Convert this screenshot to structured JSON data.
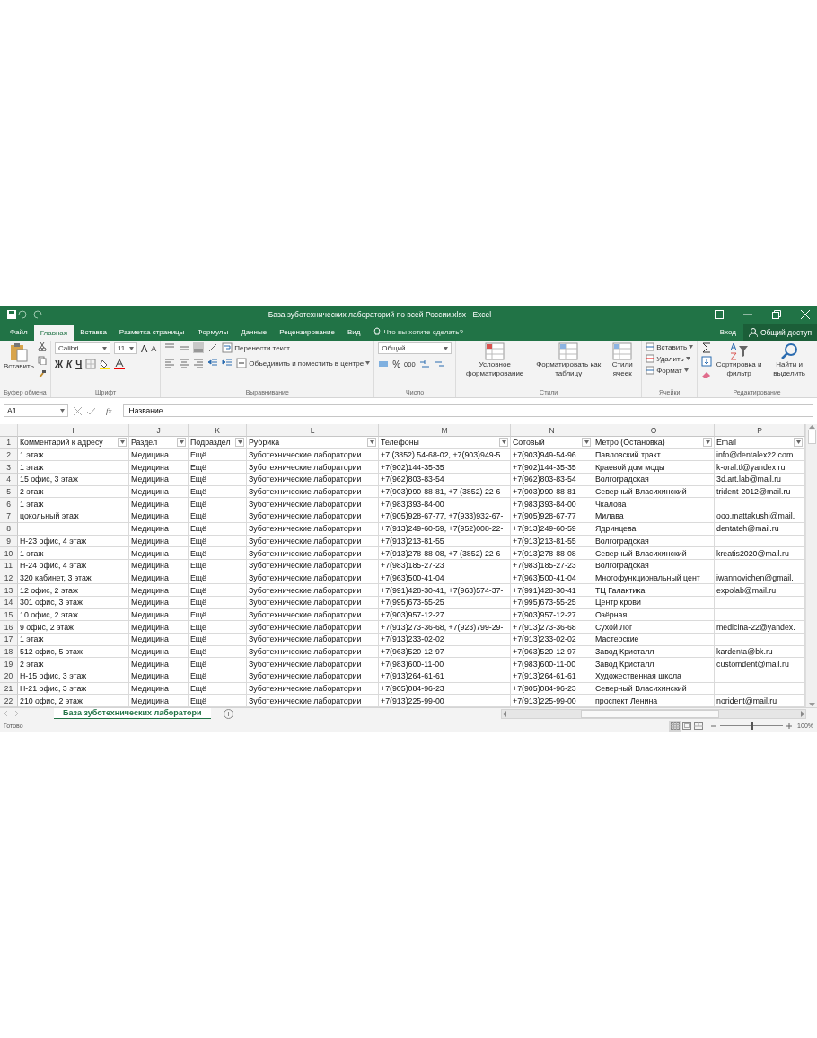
{
  "window": {
    "title": "База зуботехнических лабораторий по всей России.xlsx - Excel"
  },
  "tabs": [
    {
      "label": "Файл",
      "selected": false
    },
    {
      "label": "Главная",
      "selected": true
    },
    {
      "label": "Вставка",
      "selected": false
    },
    {
      "label": "Разметка страницы",
      "selected": false
    },
    {
      "label": "Формулы",
      "selected": false
    },
    {
      "label": "Данные",
      "selected": false
    },
    {
      "label": "Рецензирование",
      "selected": false
    },
    {
      "label": "Вид",
      "selected": false
    }
  ],
  "tell_me": {
    "placeholder": "Что вы хотите сделать?"
  },
  "sign_in": "Вход",
  "share": "Общий доступ",
  "ribbon": {
    "clipboard": {
      "label": "Буфер обмена",
      "paste": "Вставить"
    },
    "font": {
      "label": "Шрифт",
      "font": "Calibri",
      "size": "11",
      "grow": "A",
      "shrink": "A",
      "bold": "Ж",
      "italic": "К",
      "underline": "Ч"
    },
    "alignment": {
      "label": "Выравнивание",
      "wrap": "Перенести текст",
      "merge": "Объединить и поместить в центре"
    },
    "number": {
      "label": "Число",
      "format": "Общий",
      "percent": "%",
      "thousands": "000"
    },
    "styles": {
      "label": "Стили",
      "items": [
        "Условное форматирование",
        "Форматировать как таблицу",
        "Стили ячеек"
      ]
    },
    "cells": {
      "label": "Ячейки",
      "items": [
        "Вставить",
        "Удалить",
        "Формат"
      ]
    },
    "editing": {
      "label": "Редактирование",
      "items": [
        "Сортировка и фильтр",
        "Найти и выделить"
      ]
    }
  },
  "formula_bar": {
    "name_box": "A1",
    "fx": "fx",
    "value": "Название"
  },
  "table": {
    "columns": [
      "I",
      "J",
      "K",
      "L",
      "M",
      "N",
      "O",
      "P"
    ],
    "header": {
      "n": "1",
      "cells": [
        "Комментарий к адресу",
        "Раздел",
        "Подраздел",
        "Рубрика",
        "Телефоны",
        "Сотовый",
        "Метро (Остановка)",
        "Email"
      ]
    },
    "rows": [
      {
        "n": "2",
        "cells": [
          "1 этаж",
          "Медицина",
          "Ещё",
          "Зуботехнические лаборатории",
          "+7 (3852) 54-68-02, +7(903)949-5",
          "+7(903)949-54-96",
          "Павловский тракт",
          "info@dentalex22.com"
        ]
      },
      {
        "n": "3",
        "cells": [
          "1 этаж",
          "Медицина",
          "Ещё",
          "Зуботехнические лаборатории",
          "+7(902)144-35-35",
          "+7(902)144-35-35",
          "Краевой дом моды",
          "k-oral.tl@yandex.ru"
        ]
      },
      {
        "n": "4",
        "cells": [
          "15 офис, 3 этаж",
          "Медицина",
          "Ещё",
          "Зуботехнические лаборатории",
          "+7(962)803-83-54",
          "+7(962)803-83-54",
          "Волгоградская",
          "3d.art.lab@mail.ru"
        ]
      },
      {
        "n": "5",
        "cells": [
          "2 этаж",
          "Медицина",
          "Ещё",
          "Зуботехнические лаборатории",
          "+7(903)990-88-81, +7 (3852) 22-6",
          "+7(903)990-88-81",
          "Северный Власихинский",
          "trident-2012@mail.ru"
        ]
      },
      {
        "n": "6",
        "cells": [
          "1 этаж",
          "Медицина",
          "Ещё",
          "Зуботехнические лаборатории",
          "+7(983)393-84-00",
          "+7(983)393-84-00",
          "Чкалова",
          ""
        ]
      },
      {
        "n": "7",
        "cells": [
          "цокольный этаж",
          "Медицина",
          "Ещё",
          "Зуботехнические лаборатории",
          "+7(905)928-67-77, +7(933)932-67-",
          "+7(905)928-67-77",
          "Милава",
          "ooo.mattakushi@mail."
        ]
      },
      {
        "n": "8",
        "cells": [
          "",
          "Медицина",
          "Ещё",
          "Зуботехнические лаборатории",
          "+7(913)249-60-59, +7(952)008-22-",
          "+7(913)249-60-59",
          "Ядринцева",
          "dentateh@mail.ru"
        ]
      },
      {
        "n": "9",
        "cells": [
          "Н-23 офис, 4 этаж",
          "Медицина",
          "Ещё",
          "Зуботехнические лаборатории",
          "+7(913)213-81-55",
          "+7(913)213-81-55",
          "Волгоградская",
          ""
        ]
      },
      {
        "n": "10",
        "cells": [
          "1 этаж",
          "Медицина",
          "Ещё",
          "Зуботехнические лаборатории",
          "+7(913)278-88-08, +7 (3852) 22-6",
          "+7(913)278-88-08",
          "Северный Власихинский",
          "kreatis2020@mail.ru"
        ]
      },
      {
        "n": "11",
        "cells": [
          "Н-24 офис, 4 этаж",
          "Медицина",
          "Ещё",
          "Зуботехнические лаборатории",
          "+7(983)185-27-23",
          "+7(983)185-27-23",
          "Волгоградская",
          ""
        ]
      },
      {
        "n": "12",
        "cells": [
          "320 кабинет, 3 этаж",
          "Медицина",
          "Ещё",
          "Зуботехнические лаборатории",
          "+7(963)500-41-04",
          "+7(963)500-41-04",
          "Многофункциональный цент",
          "iwannovichen@gmail."
        ]
      },
      {
        "n": "13",
        "cells": [
          "12 офис, 2 этаж",
          "Медицина",
          "Ещё",
          "Зуботехнические лаборатории",
          "+7(991)428-30-41, +7(963)574-37-",
          "+7(991)428-30-41",
          "ТЦ Галактика",
          "expolab@mail.ru"
        ]
      },
      {
        "n": "14",
        "cells": [
          "301 офис, 3 этаж",
          "Медицина",
          "Ещё",
          "Зуботехнические лаборатории",
          "+7(995)673-55-25",
          "+7(995)673-55-25",
          "Центр крови",
          ""
        ]
      },
      {
        "n": "15",
        "cells": [
          "10 офис, 2 этаж",
          "Медицина",
          "Ещё",
          "Зуботехнические лаборатории",
          "+7(903)957-12-27",
          "+7(903)957-12-27",
          "Озёрная",
          ""
        ]
      },
      {
        "n": "16",
        "cells": [
          "9 офис, 2 этаж",
          "Медицина",
          "Ещё",
          "Зуботехнические лаборатории",
          "+7(913)273-36-68, +7(923)799-29-",
          "+7(913)273-36-68",
          "Сухой Лог",
          "medicina-22@yandex."
        ]
      },
      {
        "n": "17",
        "cells": [
          "1 этаж",
          "Медицина",
          "Ещё",
          "Зуботехнические лаборатории",
          "+7(913)233-02-02",
          "+7(913)233-02-02",
          "Мастерские",
          ""
        ]
      },
      {
        "n": "18",
        "cells": [
          "512 офис, 5 этаж",
          "Медицина",
          "Ещё",
          "Зуботехнические лаборатории",
          "+7(963)520-12-97",
          "+7(963)520-12-97",
          "Завод Кристалл",
          "kardenta@bk.ru"
        ]
      },
      {
        "n": "19",
        "cells": [
          "2 этаж",
          "Медицина",
          "Ещё",
          "Зуботехнические лаборатории",
          "+7(983)600-11-00",
          "+7(983)600-11-00",
          "Завод Кристалл",
          "customdent@mail.ru"
        ]
      },
      {
        "n": "20",
        "cells": [
          "Н-15 офис, 3 этаж",
          "Медицина",
          "Ещё",
          "Зуботехнические лаборатории",
          "+7(913)264-61-61",
          "+7(913)264-61-61",
          "Художественная школа",
          ""
        ]
      },
      {
        "n": "21",
        "cells": [
          "Н-21 офис, 3 этаж",
          "Медицина",
          "Ещё",
          "Зуботехнические лаборатории",
          "+7(905)084-96-23",
          "+7(905)084-96-23",
          "Северный Власихинский",
          ""
        ]
      },
      {
        "n": "22",
        "cells": [
          "210 офис, 2 этаж",
          "Медицина",
          "Ещё",
          "Зуботехнические лаборатории",
          "+7(913)225-99-00",
          "+7(913)225-99-00",
          "проспект Ленина",
          "norident@mail.ru"
        ]
      }
    ]
  },
  "sheet_tabs": [
    {
      "label": "База зуботехнических лаборатори",
      "selected": true
    }
  ],
  "status_bar": {
    "status": "Готово",
    "views": [
      {
        "kind": "normal",
        "selected": true
      },
      {
        "kind": "page_layout",
        "selected": false
      },
      {
        "kind": "page_break",
        "selected": false
      }
    ],
    "zoom": {
      "level": 0.5,
      "reading": "100%"
    }
  }
}
